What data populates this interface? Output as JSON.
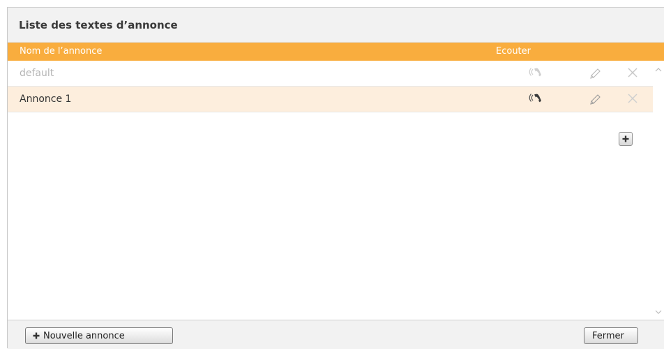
{
  "dialog": {
    "title": "Liste des textes d’annonce"
  },
  "table": {
    "columns": {
      "name": "Nom de l’annonce",
      "listen": "Ecouter"
    },
    "rows": [
      {
        "name": "default",
        "state": "disabled",
        "actions": [
          "listen-icon",
          "edit-icon",
          "delete-icon"
        ]
      },
      {
        "name": "Annonce 1",
        "state": "selected",
        "actions": [
          "listen-icon",
          "edit-icon",
          "delete-icon"
        ]
      }
    ]
  },
  "footer": {
    "new_button": "Nouvelle annonce",
    "close_button": "Fermer"
  },
  "colors": {
    "header_orange": "#f9ad3e",
    "selected_row": "#fdeedd",
    "title_bar": "#f2f2f2"
  }
}
